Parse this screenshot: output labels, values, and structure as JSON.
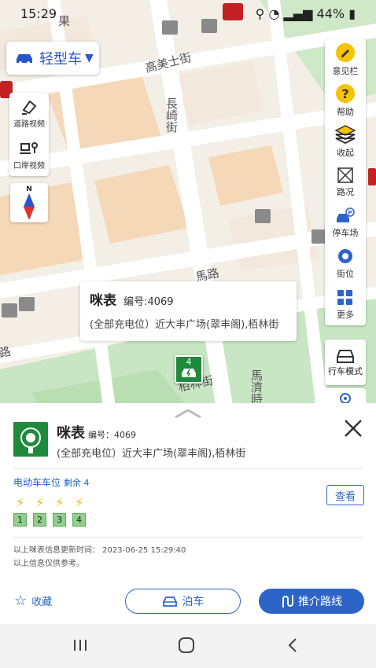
{
  "status_bar": {
    "time": "15:29",
    "battery": "44%"
  },
  "map": {
    "street_labels": [
      "高美士街",
      "長崎街",
      "栢林街",
      "馬濟時",
      "馬路",
      "路",
      "果"
    ],
    "vehicle_selector": {
      "label": "轻型车"
    },
    "left_tools": [
      {
        "label": "道路视频",
        "icon": "road-video-icon"
      },
      {
        "label": "口岸视频",
        "icon": "border-camera-icon"
      }
    ],
    "compass_letter": "N",
    "right_tools": [
      {
        "label": "意见栏",
        "icon": "feedback-icon"
      },
      {
        "label": "帮助",
        "icon": "help-icon"
      },
      {
        "label": "收起",
        "icon": "layers-icon"
      },
      {
        "label": "路况",
        "icon": "traffic-icon"
      },
      {
        "label": "停车场",
        "icon": "parking-icon"
      },
      {
        "label": "街位",
        "icon": "street-parking-icon"
      },
      {
        "label": "更多",
        "icon": "more-grid-icon"
      }
    ],
    "drive_mode": {
      "label": "行车模式"
    },
    "popup": {
      "name": "咪表",
      "code": "编号:4069",
      "address": "(全部充电位）近大丰广场(翠丰阁),栢林街"
    },
    "marker_count": "4"
  },
  "sheet": {
    "name": "咪表",
    "code": "编号：4069",
    "address": "(全部充电位）近大丰广场(翠丰阁),栢林街",
    "section_title": "电动车车位",
    "remaining": "剩余 4",
    "view_label": "查看",
    "slots": [
      "1",
      "2",
      "3",
      "4"
    ],
    "update_note": "以上咪表信息更新时间： 2023-06-25 15:29:40",
    "disclaimer": "以上信息仅供参考。",
    "favorite_label": "收藏",
    "park_label": "泊车",
    "route_label": "推介路线"
  },
  "colors": {
    "accent_blue": "#2d64c8",
    "charger_green": "#1e8a3c",
    "bolt_yellow": "#f2b90f"
  }
}
